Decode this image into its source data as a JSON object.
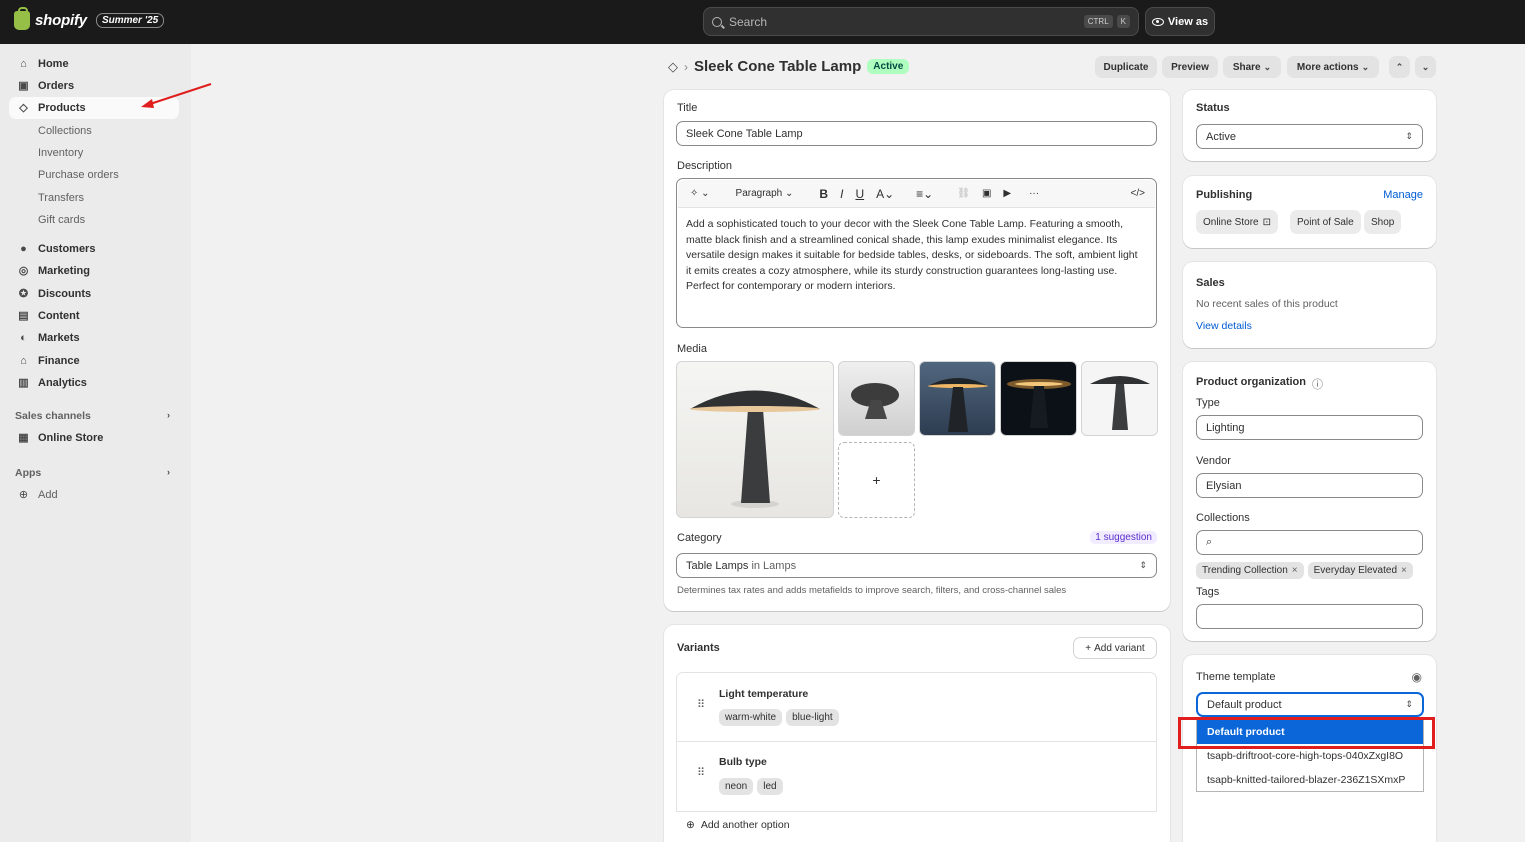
{
  "topbar": {
    "brand": "shopify",
    "edition": "Summer '25",
    "search_placeholder": "Search",
    "kbd_1": "CTRL",
    "kbd_2": "K",
    "view_as": "View as"
  },
  "sidebar": {
    "items": [
      {
        "label": "Home",
        "icon": "home-icon"
      },
      {
        "label": "Orders",
        "icon": "inbox-icon"
      },
      {
        "label": "Products",
        "icon": "tag-icon"
      }
    ],
    "product_sub": [
      "Collections",
      "Inventory",
      "Purchase orders",
      "Transfers",
      "Gift cards"
    ],
    "items2": [
      {
        "label": "Customers",
        "icon": "person-icon"
      },
      {
        "label": "Marketing",
        "icon": "target-icon"
      },
      {
        "label": "Discounts",
        "icon": "discount-icon"
      },
      {
        "label": "Content",
        "icon": "content-icon"
      },
      {
        "label": "Markets",
        "icon": "globe-icon"
      },
      {
        "label": "Finance",
        "icon": "bank-icon"
      },
      {
        "label": "Analytics",
        "icon": "chart-icon"
      }
    ],
    "sales_channels": "Sales channels",
    "online_store": "Online Store",
    "apps": "Apps",
    "add": "Add"
  },
  "header": {
    "title": "Sleek Cone Table Lamp",
    "status_badge": "Active",
    "actions": [
      "Duplicate",
      "Preview",
      "Share",
      "More actions"
    ]
  },
  "main": {
    "title_label": "Title",
    "title_value": "Sleek Cone Table Lamp",
    "description_label": "Description",
    "toolbar_paragraph": "Paragraph",
    "description_text": "Add a sophisticated touch to your decor with the Sleek Cone Table Lamp. Featuring a smooth, matte black finish and a streamlined conical shade, this lamp exudes minimalist elegance. Its versatile design makes it suitable for bedside tables, desks, or sideboards. The soft, ambient light it emits creates a cozy atmosphere, while its sturdy construction guarantees long-lasting use. Perfect for contemporary or modern interiors.",
    "media_label": "Media",
    "add_media": "+",
    "category_label": "Category",
    "category_suggestion": "1 suggestion",
    "category_value": "Table Lamps",
    "category_in": "in Lamps",
    "category_help": "Determines tax rates and adds metafields to improve search, filters, and cross-channel sales"
  },
  "variants": {
    "label": "Variants",
    "add_variant": "Add variant",
    "options": [
      {
        "name": "Light temperature",
        "values": [
          "warm-white",
          "blue-light"
        ]
      },
      {
        "name": "Bulb type",
        "values": [
          "neon",
          "led"
        ]
      }
    ],
    "add_option": "Add another option"
  },
  "status": {
    "label": "Status",
    "value": "Active"
  },
  "publishing": {
    "label": "Publishing",
    "manage": "Manage",
    "channels": [
      "Online Store",
      "Point of Sale",
      "Shop"
    ]
  },
  "sales": {
    "label": "Sales",
    "text": "No recent sales of this product",
    "link": "View details"
  },
  "organization": {
    "label": "Product organization",
    "type_label": "Type",
    "type_value": "Lighting",
    "vendor_label": "Vendor",
    "vendor_value": "Elysian",
    "collections_label": "Collections",
    "collections": [
      "Trending Collection",
      "Everyday Elevated"
    ],
    "tags_label": "Tags"
  },
  "theme": {
    "label": "Theme template",
    "value": "Default product",
    "options": [
      "Default product",
      "tsapb-driftroot-core-high-tops-040xZxgI8O",
      "tsapb-knitted-tailored-blazer-236Z1SXmxP"
    ]
  },
  "colors": {
    "accent_blue": "#0a66d9",
    "annotation_red": "#e01e1e",
    "active_badge": "#affebf"
  }
}
